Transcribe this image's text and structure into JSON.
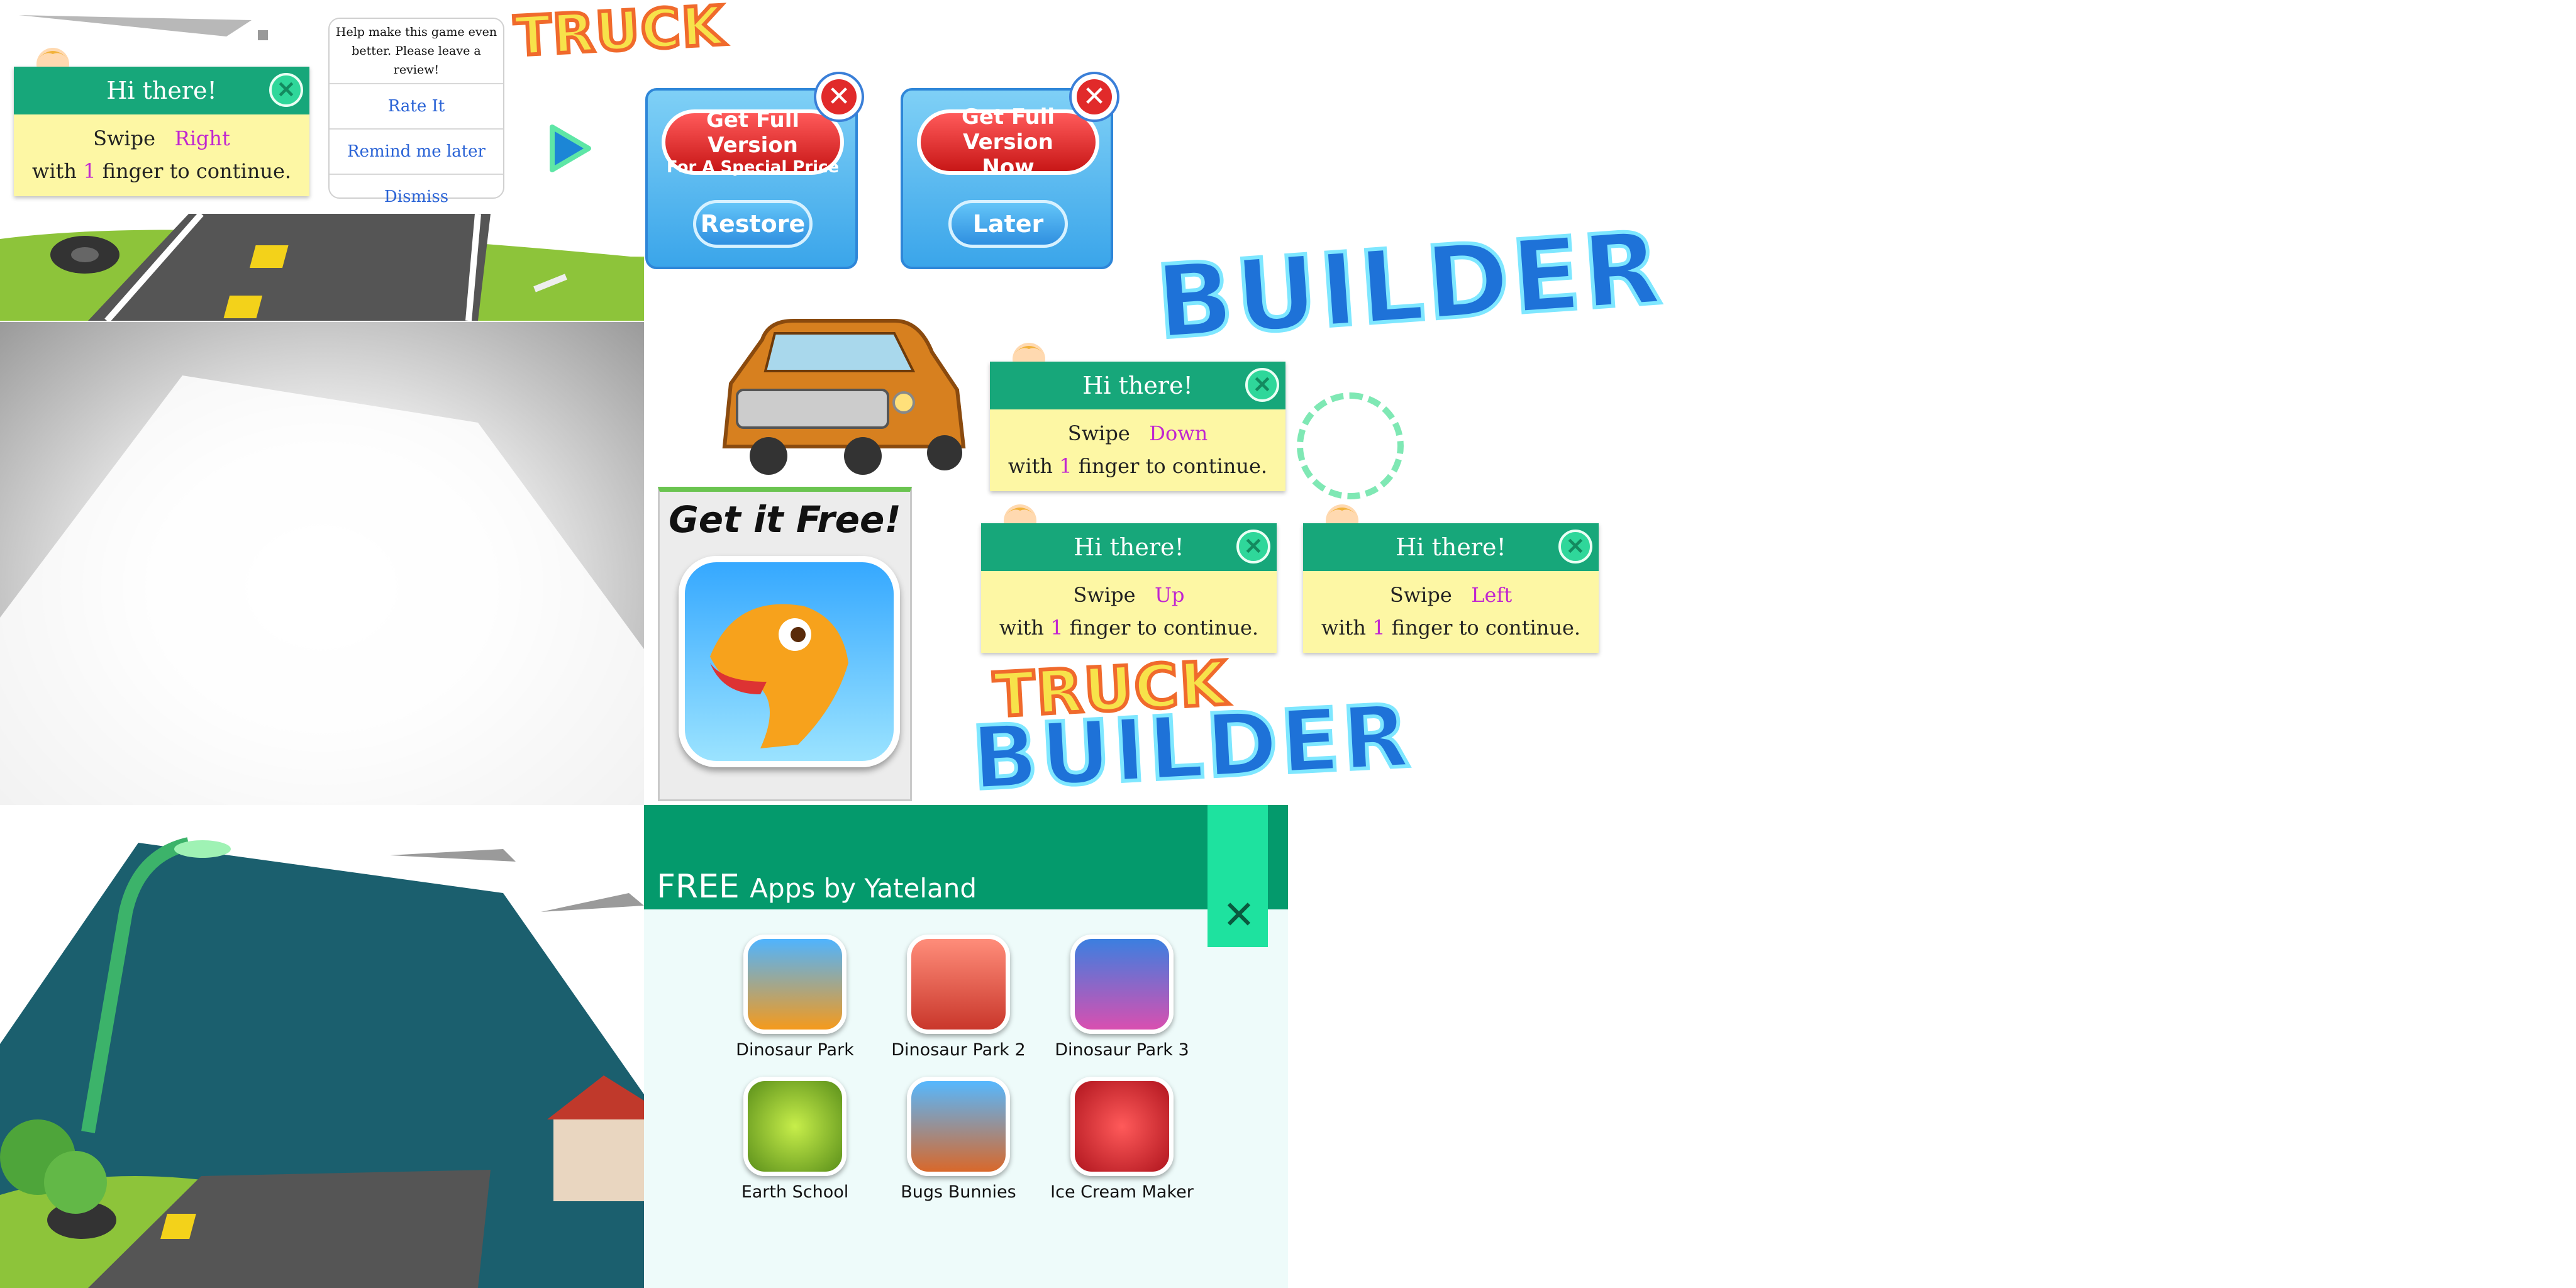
{
  "hints": [
    {
      "title": "Hi there!",
      "swipe": "Swipe",
      "direction": "Right",
      "with": "with",
      "count": "1",
      "rest": "finger to continue."
    },
    {
      "title": "Hi there!",
      "swipe": "Swipe",
      "direction": "Down",
      "with": "with",
      "count": "1",
      "rest": "finger to continue."
    },
    {
      "title": "Hi there!",
      "swipe": "Swipe",
      "direction": "Up",
      "with": "with",
      "count": "1",
      "rest": "finger to continue."
    },
    {
      "title": "Hi there!",
      "swipe": "Swipe",
      "direction": "Left",
      "with": "with",
      "count": "1",
      "rest": "finger to continue."
    }
  ],
  "review": {
    "message": "Help make this game even better. Please leave a review!",
    "rate": "Rate It",
    "remind": "Remind me later",
    "dismiss": "Dismiss"
  },
  "purchase": [
    {
      "main_line1": "Get Full Version",
      "main_line2": "For A Special Price",
      "secondary": "Restore"
    },
    {
      "main_line1": "Get Full Version",
      "main_line2": "Now",
      "secondary": "Later"
    }
  ],
  "logo": {
    "truck": "TRUCK",
    "builder": "BUILDER"
  },
  "free_promo": {
    "title": "Get it Free!"
  },
  "free_apps": {
    "title_bold": "FREE",
    "title_rest": "Apps by Yateland",
    "apps": [
      {
        "name": "Dinosaur Park",
        "color": "#f59a1c"
      },
      {
        "name": "Dinosaur Park 2",
        "color": "#e0483a"
      },
      {
        "name": "Dinosaur Park 3",
        "color": "#d94fb0"
      },
      {
        "name": "Earth School",
        "color": "#a8d82c"
      },
      {
        "name": "Bugs Bunnies",
        "color": "#d9682a"
      },
      {
        "name": "Ice Cream Maker",
        "color": "#e52a3a"
      }
    ]
  },
  "icons": [
    "close-icon",
    "play-icon",
    "kid-avatar-icon",
    "truck-icon",
    "pterodactyl-icon"
  ]
}
